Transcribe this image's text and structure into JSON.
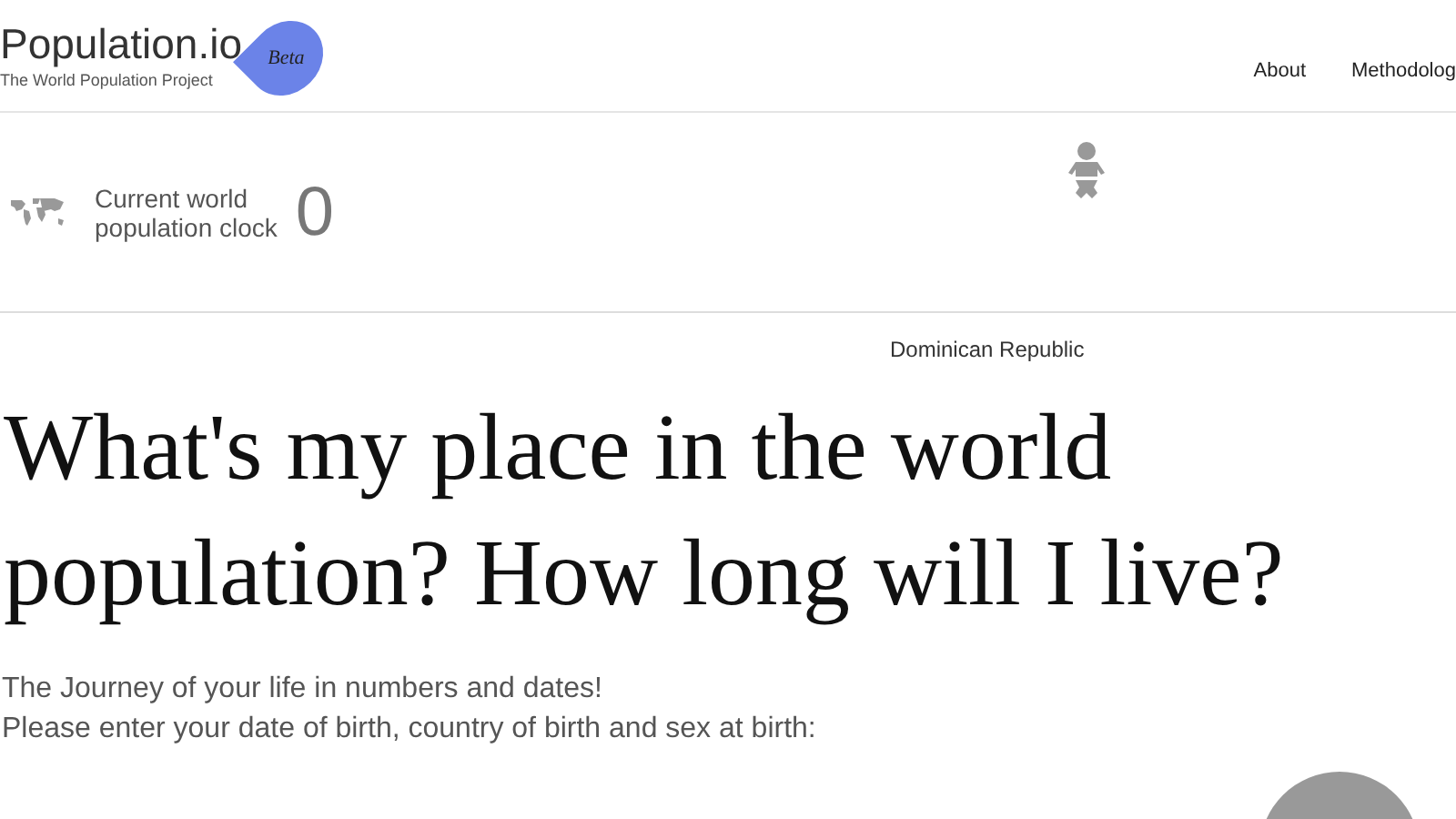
{
  "header": {
    "logo": "Population.io",
    "badge": "Beta",
    "tagline": "The World Population Project",
    "nav": [
      "About",
      "Methodolog"
    ]
  },
  "clock": {
    "label_line1": "Current world",
    "label_line2": "population clock",
    "value": "0"
  },
  "country": "Dominican Republic",
  "heading_line1": "What's my place in the world",
  "heading_line2": "population? How long will I live?",
  "intro_line1": "The Journey of your life in numbers and dates!",
  "intro_line2": "Please enter your date of birth, country of birth and sex at birth:"
}
